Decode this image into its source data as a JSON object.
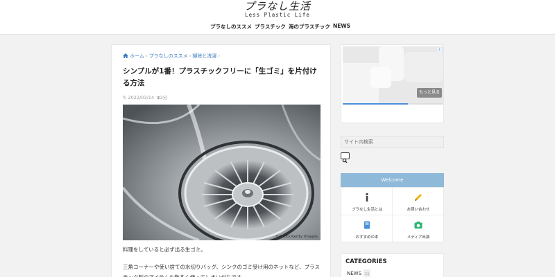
{
  "header": {
    "logo_main": "プラなし生活",
    "logo_sub": "Less Plastic Life",
    "nav": [
      "プラなしのススメ",
      "プラスチック",
      "海のプラスチック",
      "NEWS"
    ]
  },
  "article": {
    "breadcrumb": [
      "ホーム",
      "プラなしのススメ",
      "掃除と洗濯"
    ],
    "title": "シンプルが1番！プラスチックフリーに「生ゴミ」を片付ける方法",
    "date": "2022/03/14",
    "read_time": "3分",
    "image_credit": "©iStock/Getty Images",
    "paragraphs": [
      "料理をしていると必ず出る生ゴミ。",
      "三角コーナーや使い捨ての水切りバッグ、シンクのゴミ受け用のネットなど、プラスチック製のアイテムを数多く使ってしまいがちです。"
    ]
  },
  "sidebar": {
    "ad_button": "もっと見る",
    "ad_badge": "i",
    "ad_progress": 0.65,
    "search_placeholder": "サイト内検索",
    "welcome_title": "Welcome",
    "welcome_items": [
      {
        "label": "プラなし生活とは",
        "icon": "info-icon",
        "color": "#444444"
      },
      {
        "label": "お問い合わせ",
        "icon": "pencil-icon",
        "color": "#f0b400"
      },
      {
        "label": "おすすめの本",
        "icon": "book-icon",
        "color": "#4a90d9"
      },
      {
        "label": "メディア出演",
        "icon": "camera-icon",
        "color": "#2bb573"
      }
    ],
    "categories_title": "CATEGORIES",
    "categories": [
      {
        "name": "NEWS",
        "count": "11"
      }
    ]
  },
  "colors": {
    "link": "#3a7bbf",
    "welcome_bg": "#8fb9d9",
    "page_bg": "#f2f2f2"
  }
}
